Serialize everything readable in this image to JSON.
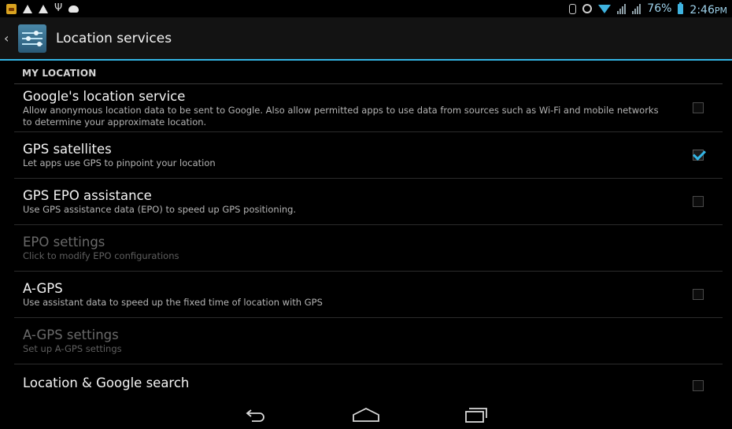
{
  "status_bar": {
    "left_icons": [
      "app-notification-icon",
      "warning-icon",
      "warning-icon",
      "usb-icon",
      "debug-icon"
    ],
    "right_icons": [
      "sim-icon",
      "alarm-icon",
      "wifi-icon",
      "signal-icon",
      "signal-icon"
    ],
    "battery": "76%",
    "time": "2:46",
    "ampm": "PM"
  },
  "action_bar": {
    "title": "Location services",
    "icon": "settings-sliders-icon"
  },
  "section": {
    "header": "MY LOCATION"
  },
  "preferences": [
    {
      "title": "Google's location service",
      "summary": "Allow anonymous location data to be sent to Google. Also allow permitted apps to use data from sources such as Wi-Fi and mobile networks to determine your approximate location.",
      "checked": false,
      "enabled": true
    },
    {
      "title": "GPS satellites",
      "summary": "Let apps use GPS to pinpoint your location",
      "checked": true,
      "enabled": true
    },
    {
      "title": "GPS EPO assistance",
      "summary": "Use GPS assistance data (EPO) to speed up GPS positioning.",
      "checked": false,
      "enabled": true
    },
    {
      "title": "EPO settings",
      "summary": "Click to modify EPO configurations",
      "enabled": false
    },
    {
      "title": "A-GPS",
      "summary": "Use assistant data to speed up the fixed time of location with GPS",
      "checked": false,
      "enabled": true
    },
    {
      "title": "A-GPS settings",
      "summary": "Set up A-GPS settings",
      "enabled": false
    },
    {
      "title": "Location & Google search",
      "summary": "",
      "checked": false,
      "enabled": true
    }
  ],
  "nav_bar": {
    "buttons": [
      "back-icon",
      "home-icon",
      "recent-apps-icon"
    ]
  },
  "colors": {
    "accent": "#33b5e5",
    "background": "#000000",
    "action_bar": "#131313"
  }
}
